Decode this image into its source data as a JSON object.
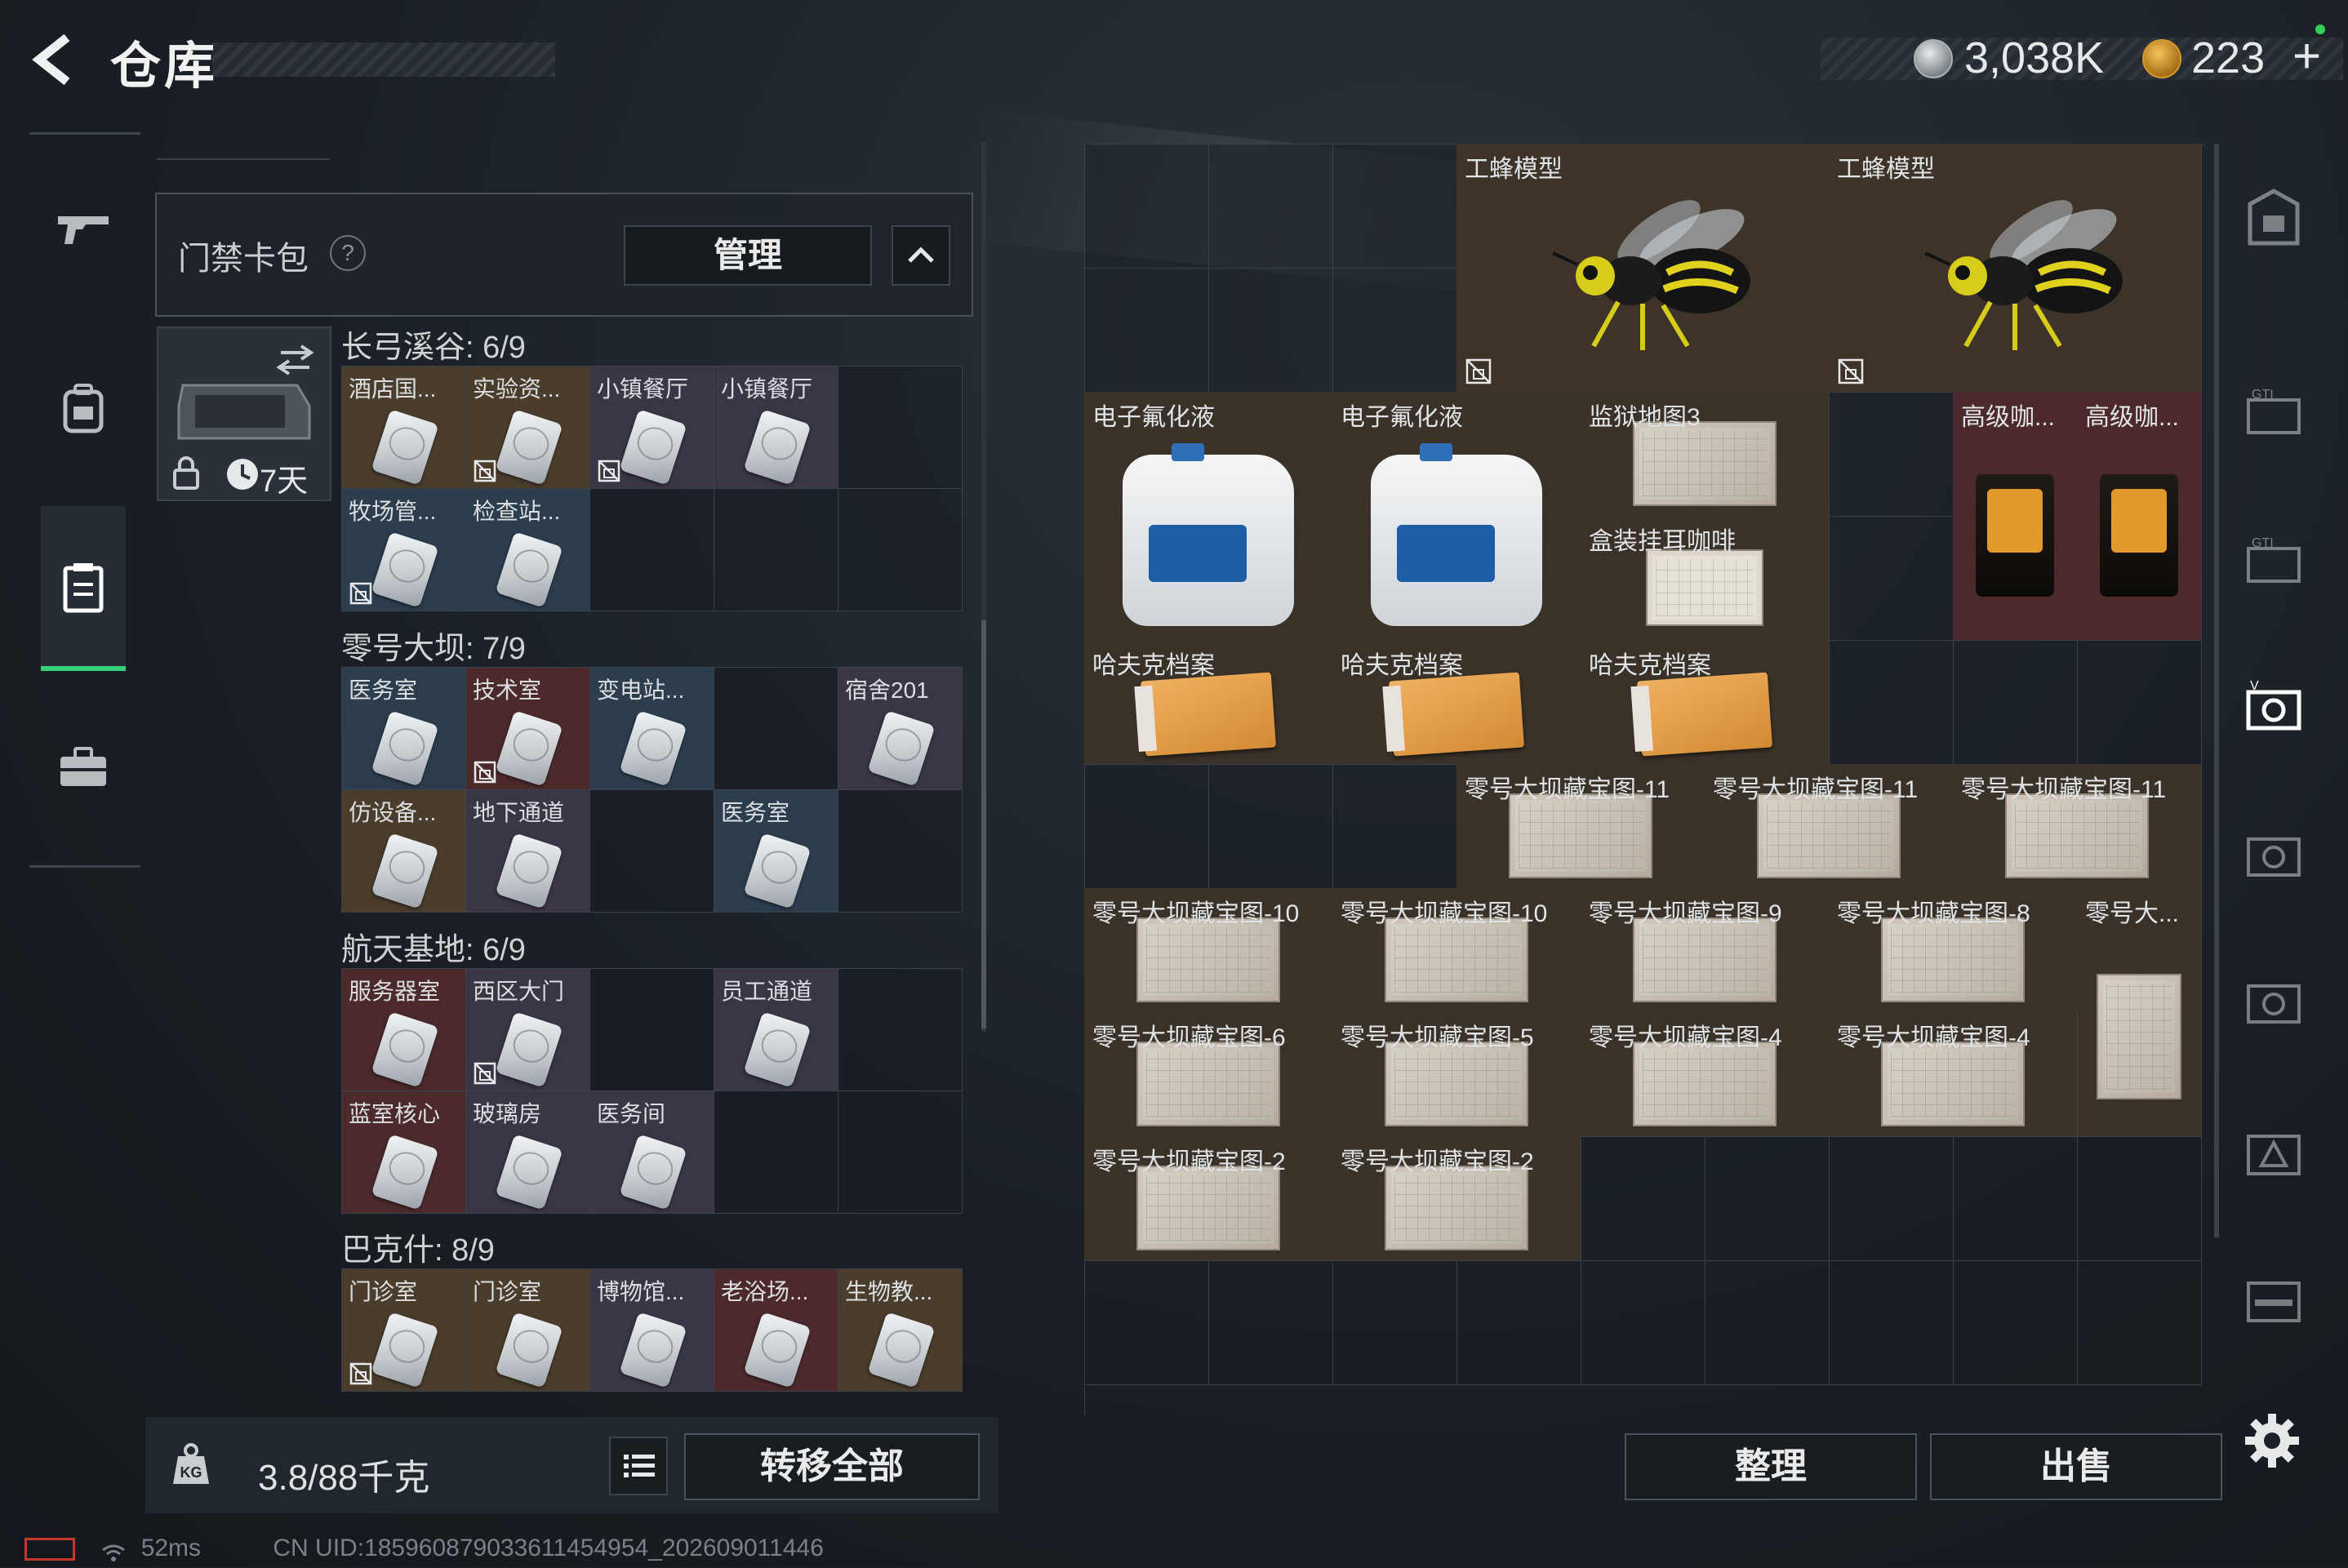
{
  "header": {
    "title": "仓库"
  },
  "currency": {
    "silver": "3,038K",
    "gold": "223",
    "gold_plus": "+"
  },
  "left_panel": {
    "pack_title": "门禁卡包",
    "help": "?",
    "manage_label": "管理",
    "pack_time": "7天",
    "sections": [
      {
        "title": "长弓溪谷: 6/9",
        "cards": [
          {
            "label": "酒店国...",
            "tone": "gold",
            "locked": false
          },
          {
            "label": "实验资...",
            "tone": "gold",
            "locked": true
          },
          {
            "label": "小镇餐厅",
            "tone": "purple",
            "locked": true
          },
          {
            "label": "小镇餐厅",
            "tone": "purple",
            "locked": false
          },
          {
            "label": "",
            "tone": "empty",
            "locked": false
          },
          {
            "label": "牧场管...",
            "tone": "blue",
            "locked": true
          },
          {
            "label": "检查站...",
            "tone": "blue",
            "locked": false
          },
          {
            "label": "",
            "tone": "empty",
            "locked": false
          },
          {
            "label": "",
            "tone": "empty",
            "locked": false
          }
        ]
      },
      {
        "title": "零号大坝: 7/9",
        "cards": [
          {
            "label": "医务室",
            "tone": "blue",
            "locked": false
          },
          {
            "label": "技术室",
            "tone": "red",
            "locked": true
          },
          {
            "label": "变电站...",
            "tone": "blue",
            "locked": false
          },
          {
            "label": "",
            "tone": "empty",
            "locked": false
          },
          {
            "label": "宿舍201",
            "tone": "purple",
            "locked": false
          },
          {
            "label": "仿设备...",
            "tone": "gold",
            "locked": false
          },
          {
            "label": "地下通道",
            "tone": "purple",
            "locked": false
          },
          {
            "label": "",
            "tone": "empty",
            "locked": false
          },
          {
            "label": "医务室",
            "tone": "blue",
            "locked": false
          }
        ]
      },
      {
        "title": "航天基地: 6/9",
        "cards": [
          {
            "label": "服务器室",
            "tone": "red",
            "locked": false
          },
          {
            "label": "西区大门",
            "tone": "purple",
            "locked": true
          },
          {
            "label": "",
            "tone": "empty",
            "locked": false
          },
          {
            "label": "员工通道",
            "tone": "purple",
            "locked": false
          },
          {
            "label": "",
            "tone": "empty",
            "locked": false
          },
          {
            "label": "蓝室核心",
            "tone": "red",
            "locked": false
          },
          {
            "label": "玻璃房",
            "tone": "purple",
            "locked": false
          },
          {
            "label": "医务间",
            "tone": "purple",
            "locked": false
          },
          {
            "label": "",
            "tone": "empty",
            "locked": false
          }
        ]
      },
      {
        "title": "巴克什: 8/9",
        "cards": [
          {
            "label": "门诊室",
            "tone": "gold",
            "locked": true
          },
          {
            "label": "门诊室",
            "tone": "gold",
            "locked": false
          },
          {
            "label": "博物馆...",
            "tone": "purple",
            "locked": false
          },
          {
            "label": "老浴场...",
            "tone": "red",
            "locked": false
          },
          {
            "label": "生物教...",
            "tone": "gold",
            "locked": false
          }
        ]
      }
    ],
    "weight": "3.8/88千克",
    "transfer_label": "转移全部"
  },
  "warehouse": {
    "items": [
      {
        "label": "工蜂模型",
        "kind": "bee",
        "locked": true
      },
      {
        "label": "工蜂模型",
        "kind": "bee",
        "locked": true
      },
      {
        "label": "电子氟化液",
        "kind": "jug"
      },
      {
        "label": "电子氟化液",
        "kind": "jug"
      },
      {
        "label": "监狱地图3",
        "kind": "map"
      },
      {
        "label": "盒装挂耳咖啡",
        "kind": "box"
      },
      {
        "label": "高级咖...",
        "kind": "coffee"
      },
      {
        "label": "高级咖...",
        "kind": "coffee"
      },
      {
        "label": "哈夫克档案",
        "kind": "file"
      },
      {
        "label": "哈夫克档案",
        "kind": "file"
      },
      {
        "label": "哈夫克档案",
        "kind": "file"
      },
      {
        "label": "零号大坝藏宝图-11",
        "kind": "map"
      },
      {
        "label": "零号大坝藏宝图-11",
        "kind": "map"
      },
      {
        "label": "零号大坝藏宝图-11",
        "kind": "map"
      },
      {
        "label": "零号大坝藏宝图-10",
        "kind": "map"
      },
      {
        "label": "零号大坝藏宝图-10",
        "kind": "map"
      },
      {
        "label": "零号大坝藏宝图-9",
        "kind": "map"
      },
      {
        "label": "零号大坝藏宝图-8",
        "kind": "map"
      },
      {
        "label": "零号大...",
        "kind": "map-tall"
      },
      {
        "label": "零号大坝藏宝图-6",
        "kind": "map"
      },
      {
        "label": "零号大坝藏宝图-5",
        "kind": "map"
      },
      {
        "label": "零号大坝藏宝图-4",
        "kind": "map"
      },
      {
        "label": "零号大坝藏宝图-4",
        "kind": "map"
      },
      {
        "label": "零号大坝藏宝图-2",
        "kind": "map"
      },
      {
        "label": "零号大坝藏宝图-2",
        "kind": "map"
      }
    ],
    "sort_label": "整理",
    "sell_label": "出售"
  },
  "footer": {
    "ping": "52ms",
    "uid": "CN UID:185960879033611454954_202609011446"
  },
  "colors": {
    "accent": "#35d07a",
    "gold_tone": "#4b3d2c",
    "red_tone": "#4c2a2c",
    "blue_tone": "#2c3d4e",
    "purple_tone": "#3a3646"
  }
}
